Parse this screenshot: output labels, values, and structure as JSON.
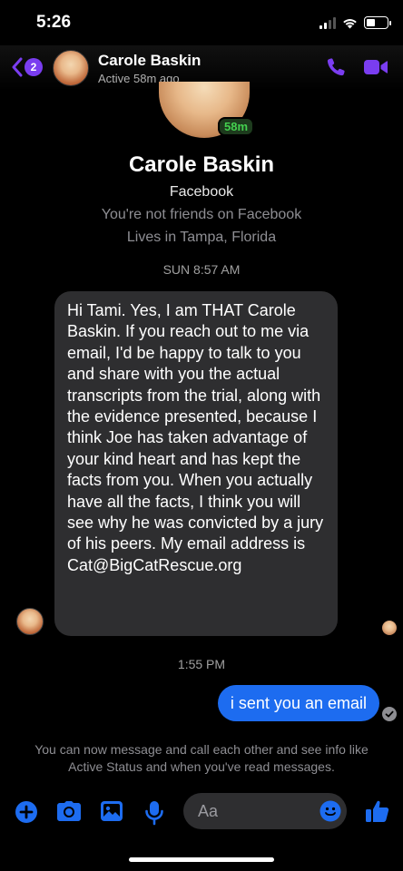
{
  "status_bar": {
    "time": "5:26",
    "battery_level_percent": 45
  },
  "header": {
    "back_badge": "2",
    "contact_name": "Carole Baskin",
    "active_status": "Active 58m ago",
    "accent_color": "#7a3df0"
  },
  "profile": {
    "active_badge": "58m",
    "name": "Carole Baskin",
    "source": "Facebook",
    "friend_status": "You're not friends on Facebook",
    "location": "Lives in Tampa, Florida"
  },
  "messages": [
    {
      "timestamp": "SUN 8:57 AM",
      "direction": "incoming",
      "text": "Hi Tami.  Yes, I am THAT Carole Baskin.  If you reach out to me via email, I'd be happy to talk to you and share with you the actual transcripts from the trial, along with the evidence presented, because I think Joe has taken advantage of your kind heart and has kept the facts from you.  When you actually have all the facts, I think you will see why he was convicted by a jury of his peers.  My email address is Cat@BigCatRescue.org"
    },
    {
      "timestamp": "1:55 PM",
      "direction": "outgoing",
      "text": "i sent you an email",
      "bubble_color": "#1d6cf0"
    }
  ],
  "info_text": "You can now message and call each other and see info like Active Status and when you've read messages.",
  "composer": {
    "placeholder": "Aa"
  },
  "icons": {
    "back": "chevron-left-icon",
    "call": "phone-icon",
    "video": "video-camera-icon",
    "plus": "plus-circle-icon",
    "camera": "camera-icon",
    "photo": "photo-icon",
    "mic": "microphone-icon",
    "emoji": "emoji-icon",
    "like": "thumbs-up-icon",
    "delivered": "check-circle-icon"
  }
}
